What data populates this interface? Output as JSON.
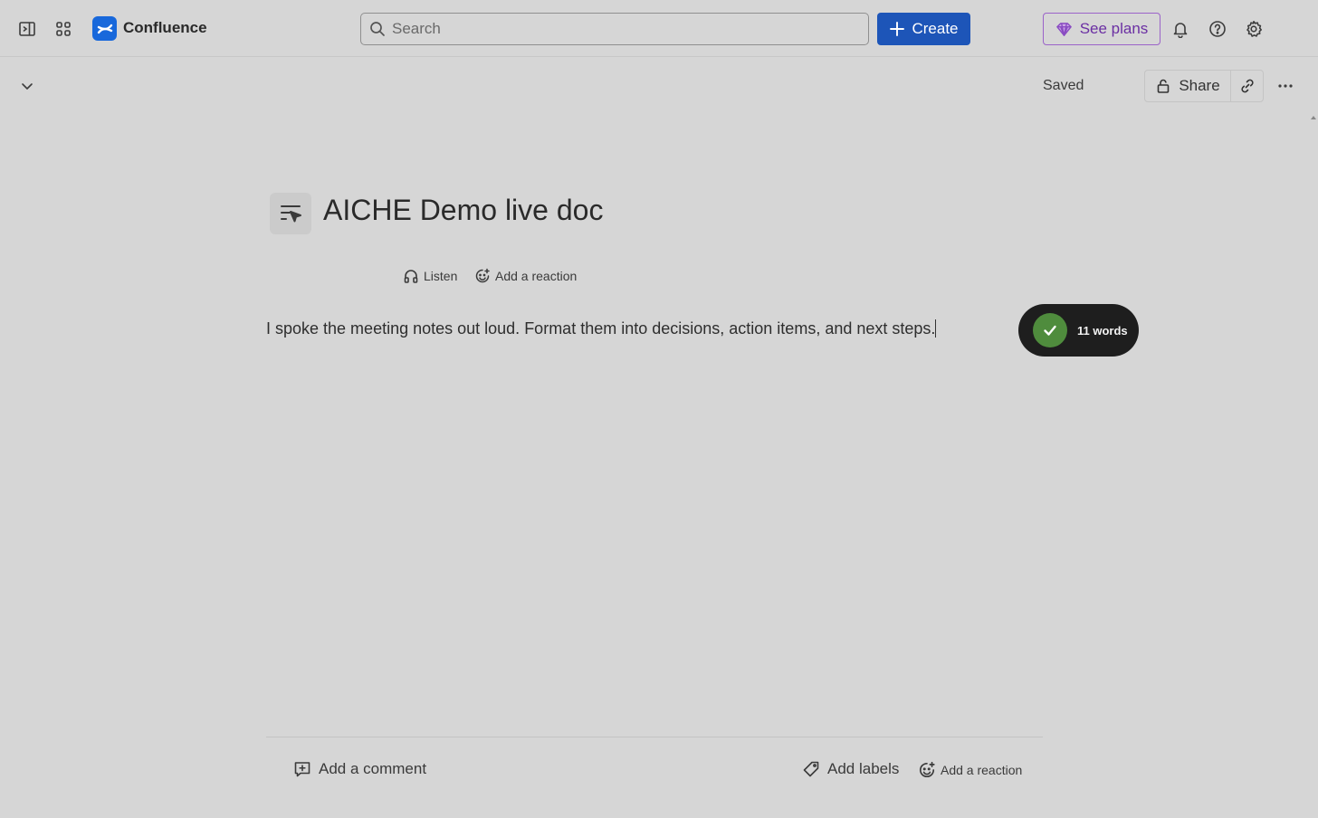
{
  "topbar": {
    "brand": "Confluence",
    "search_placeholder": "Search",
    "create_label": "Create",
    "see_plans_label": "See plans",
    "icons": [
      "sidebar-toggle-icon",
      "app-switcher-icon",
      "confluence-logo",
      "bell-icon",
      "help-icon",
      "gear-icon"
    ]
  },
  "page_toolbar": {
    "status": "Saved",
    "share_label": "Share"
  },
  "page": {
    "title": "AICHE Demo live doc",
    "listen_label": "Listen",
    "add_reaction_label": "Add a reaction",
    "body": "I spoke the meeting notes out loud. Format them into decisions, action items, and next steps."
  },
  "dictation_pill": {
    "word_count": "11 words",
    "accent_color": "#4f8c3d"
  },
  "footer": {
    "add_comment_label": "Add a comment",
    "add_labels_label": "Add labels",
    "add_reaction_label": "Add a reaction"
  },
  "colors": {
    "background": "#d6d6d6",
    "primary_button": "#1d55b8",
    "plans_accent": "#6b2fa3"
  }
}
